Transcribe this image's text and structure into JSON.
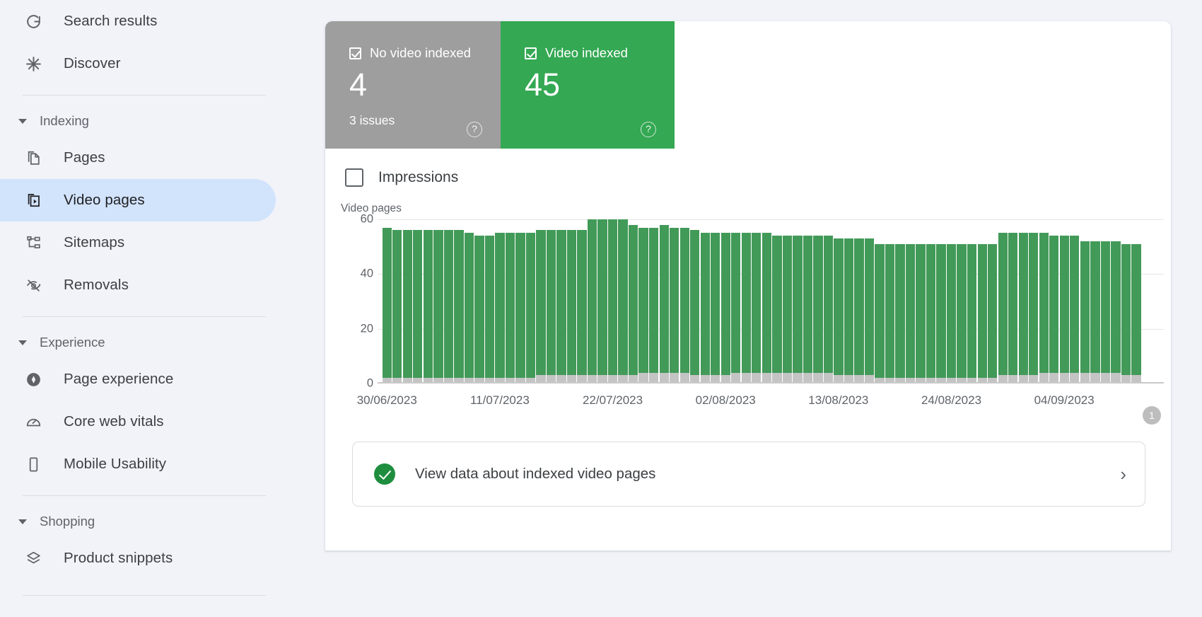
{
  "sidebar": {
    "groups": [
      {
        "id": "top",
        "header": null,
        "items": [
          {
            "label": "Search results",
            "icon": "google-g-icon",
            "selected": false
          },
          {
            "label": "Discover",
            "icon": "discover-asterisk-icon",
            "selected": false
          }
        ]
      },
      {
        "id": "indexing",
        "header": "Indexing",
        "items": [
          {
            "label": "Pages",
            "icon": "pages-copy-icon",
            "selected": false
          },
          {
            "label": "Video pages",
            "icon": "video-pages-icon",
            "selected": true
          },
          {
            "label": "Sitemaps",
            "icon": "sitemaps-hierarchy-icon",
            "selected": false
          },
          {
            "label": "Removals",
            "icon": "removals-eye-off-icon",
            "selected": false
          }
        ]
      },
      {
        "id": "experience",
        "header": "Experience",
        "items": [
          {
            "label": "Page experience",
            "icon": "page-experience-icon",
            "selected": false
          },
          {
            "label": "Core web vitals",
            "icon": "core-web-vitals-gauge-icon",
            "selected": false
          },
          {
            "label": "Mobile Usability",
            "icon": "mobile-phone-icon",
            "selected": false
          }
        ]
      },
      {
        "id": "shopping",
        "header": "Shopping",
        "items": [
          {
            "label": "Product snippets",
            "icon": "product-snippets-layers-icon",
            "selected": false
          }
        ]
      }
    ]
  },
  "status_tiles": [
    {
      "id": "no-video-indexed",
      "label": "No video indexed",
      "value": "4",
      "sub": "3 issues",
      "color": "#9e9e9e",
      "checked": true,
      "help": "?"
    },
    {
      "id": "video-indexed",
      "label": "Video indexed",
      "value": "45",
      "sub": "",
      "color": "#34a853",
      "checked": true,
      "help": "?"
    }
  ],
  "impressions": {
    "label": "Impressions",
    "checked": false
  },
  "banner": {
    "text": "View data about indexed video pages",
    "chevron": "›",
    "icon": "check-circle-icon"
  },
  "chart_data": {
    "type": "bar",
    "stacked": true,
    "title": "Video pages",
    "xlabel": "",
    "ylabel": "Video pages",
    "ylim": [
      0,
      60
    ],
    "yticks": [
      0,
      20,
      40,
      60
    ],
    "grid": true,
    "legend_position": "top",
    "annotation_badge": "1",
    "xtick_labels": [
      "30/06/2023",
      "11/07/2023",
      "22/07/2023",
      "02/08/2023",
      "13/08/2023",
      "24/08/2023",
      "04/09/2023"
    ],
    "xtick_indices": [
      0,
      11,
      22,
      33,
      44,
      55,
      66
    ],
    "series": [
      {
        "name": "No video indexed",
        "color": "#c4c4c4",
        "values": [
          2,
          2,
          2,
          2,
          2,
          2,
          2,
          2,
          2,
          2,
          2,
          2,
          2,
          2,
          2,
          3,
          3,
          3,
          3,
          3,
          3,
          3,
          3,
          3,
          3,
          4,
          4,
          4,
          4,
          4,
          3,
          3,
          3,
          3,
          4,
          4,
          4,
          4,
          4,
          4,
          4,
          4,
          4,
          4,
          3,
          3,
          3,
          3,
          2,
          2,
          2,
          2,
          2,
          2,
          2,
          2,
          2,
          2,
          2,
          2,
          3,
          3,
          3,
          3,
          4,
          4,
          4,
          4,
          4,
          4,
          4,
          4,
          3,
          3
        ]
      },
      {
        "name": "Video indexed",
        "color": "#429a58",
        "values": [
          55,
          54,
          54,
          54,
          54,
          54,
          54,
          54,
          53,
          52,
          52,
          53,
          53,
          53,
          53,
          53,
          53,
          53,
          53,
          53,
          57,
          57,
          57,
          57,
          55,
          53,
          53,
          54,
          53,
          53,
          53,
          52,
          52,
          52,
          51,
          51,
          51,
          51,
          50,
          50,
          50,
          50,
          50,
          50,
          50,
          50,
          50,
          50,
          49,
          49,
          49,
          49,
          49,
          49,
          49,
          49,
          49,
          49,
          49,
          49,
          52,
          52,
          52,
          52,
          51,
          50,
          50,
          50,
          48,
          48,
          48,
          48,
          48,
          48
        ]
      }
    ]
  }
}
